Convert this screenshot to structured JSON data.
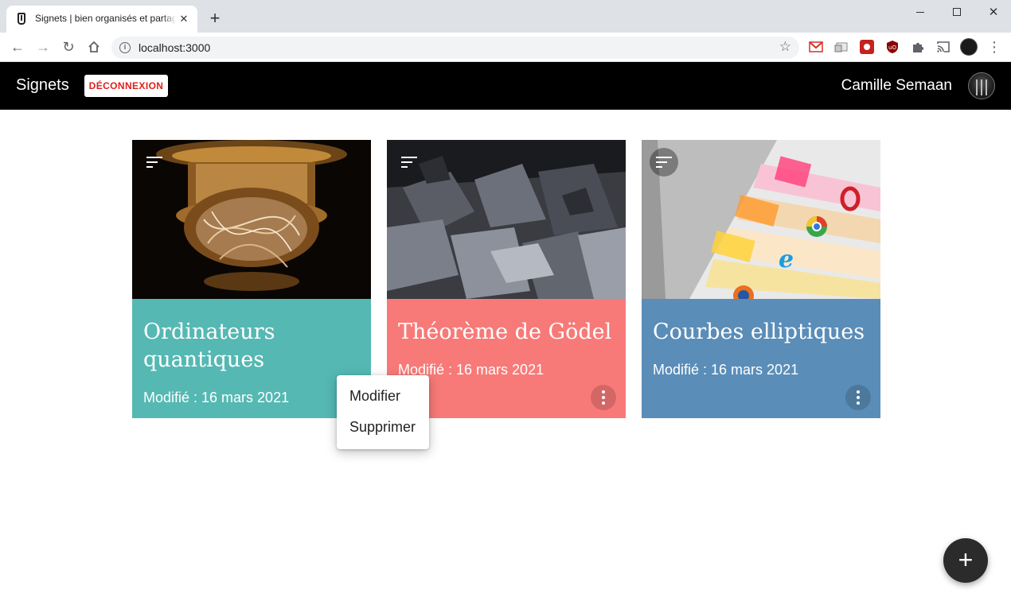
{
  "browser": {
    "tab_title": "Signets | bien organisés et partagés",
    "tab_close": "✕",
    "new_tab": "+",
    "url": "localhost:3000",
    "extensions": [
      {
        "name": "gmail-extension-icon",
        "color": "#d93025"
      },
      {
        "name": "cast-extension-icon",
        "color": "#8a8a8a"
      },
      {
        "name": "red-extension-icon",
        "color": "#c5221f"
      },
      {
        "name": "ublock-extension-icon",
        "color": "#8b0000"
      },
      {
        "name": "puzzle-extensions-icon",
        "color": "#5f6368"
      },
      {
        "name": "media-cast-icon",
        "color": "#5f6368"
      }
    ]
  },
  "app": {
    "title": "Signets",
    "logout_label": "DÉCONNEXION",
    "user_name": "Camille Semaan"
  },
  "cards": [
    {
      "title": "Ordinateurs quantiques",
      "date": "Modifié : 16 mars 2021",
      "color": "#55b8b3"
    },
    {
      "title": "Théorème de Gödel",
      "date": "Modifié : 16 mars 2021",
      "color": "#f77a78"
    },
    {
      "title": "Courbes elliptiques",
      "date": "Modifié : 16 mars 2021",
      "color": "#5a8db8"
    }
  ],
  "context_menu": {
    "items": [
      "Modifier",
      "Supprimer"
    ]
  },
  "fab_label": "+"
}
